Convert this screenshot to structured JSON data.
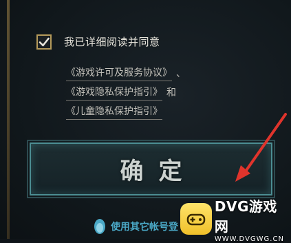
{
  "consent": {
    "checked": true,
    "label": "我已详细阅读并同意"
  },
  "agreements": {
    "line1": {
      "link": "《游戏许可及服务协议》",
      "sep": "、"
    },
    "line2": {
      "link": "《游戏隐私保护指引》",
      "sep": "和"
    },
    "line3": {
      "link": "《儿童隐私保护指引》"
    }
  },
  "confirm_button": {
    "label": "确定"
  },
  "alt_login": {
    "label": "使用其它帐号登"
  },
  "watermark": {
    "title": "DVG游戏网",
    "url": "WWW.DVGWG.CN"
  },
  "colors": {
    "accent": "#4c8e93",
    "checkbox_border": "#b59a5a",
    "arrow": "#e0342c",
    "link_blue": "#4aa8c6",
    "brand_yellow": "#f0c02a"
  }
}
